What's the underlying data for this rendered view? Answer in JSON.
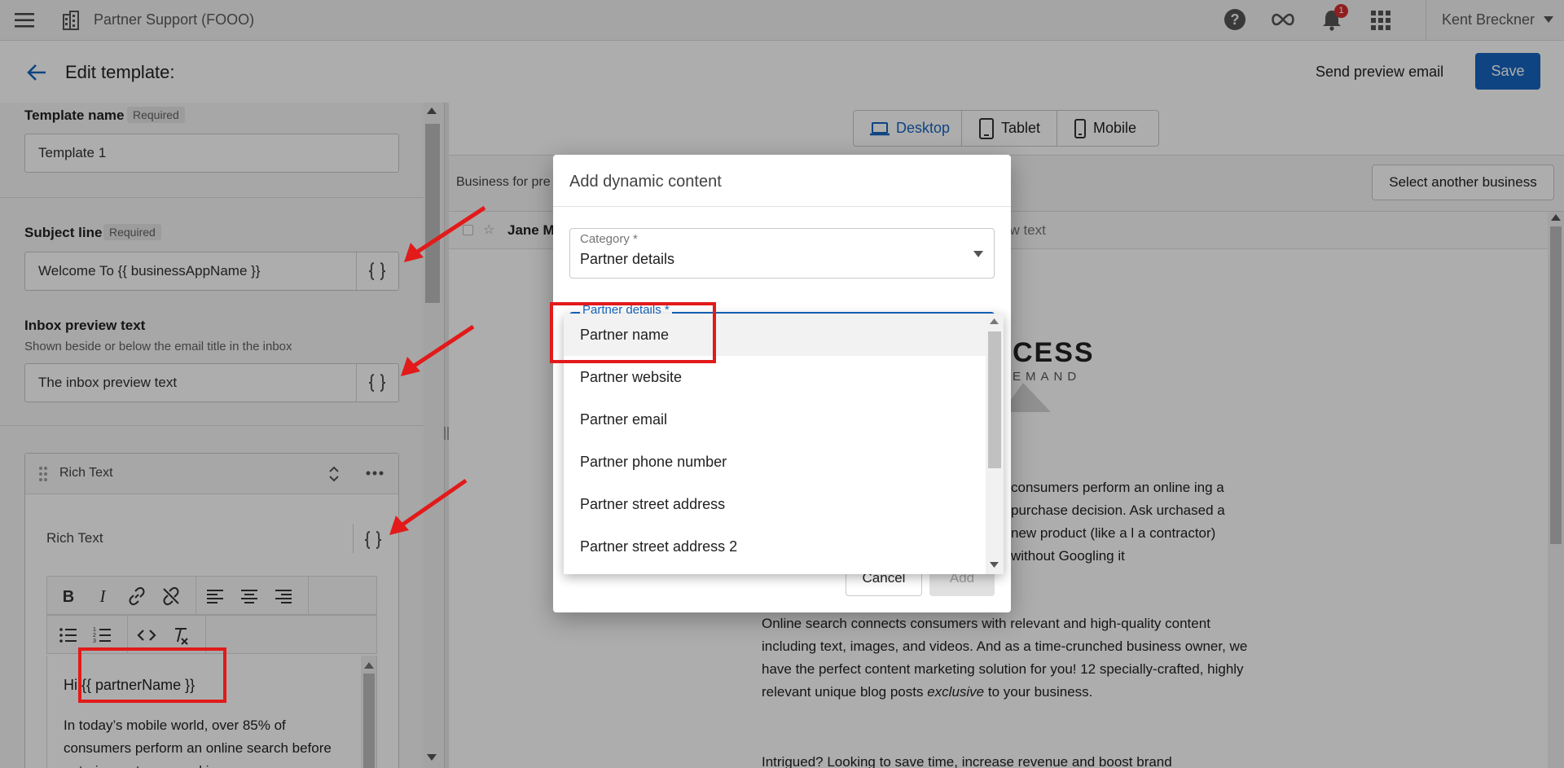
{
  "topbar": {
    "title": "Partner Support (FOOO)",
    "notification_count": "1",
    "user": "Kent Breckner"
  },
  "header": {
    "title": "Edit template:",
    "preview_link": "Send preview email",
    "save_label": "Save"
  },
  "form": {
    "template_name": {
      "label": "Template name",
      "required": "Required",
      "value": "Template 1"
    },
    "subject_line": {
      "label": "Subject line",
      "required": "Required",
      "value": "Welcome To {{ businessAppName }}"
    },
    "inbox_preview": {
      "label": "Inbox preview text",
      "hint": "Shown beside or below the email title in the inbox",
      "value": "The inbox preview text"
    }
  },
  "rich_text": {
    "title": "Rich Text",
    "label": "Rich Text",
    "editor_greeting": "Hi",
    "editor_token": "{{ partnerName }}",
    "editor_body": "In today’s mobile world, over 85% of consumers perform an online search before entering a store or making a"
  },
  "preview": {
    "devices": [
      "Desktop",
      "Tablet",
      "Mobile"
    ],
    "active_device": "Desktop",
    "business_label": "Business for pre",
    "select_business": "Select another business",
    "sender": "Jane M",
    "snippet": "ew text",
    "logo_text": "CESS",
    "logo_sub": "EMAND",
    "paragraph1": "consumers perform an online ing a purchase decision. Ask urchased a new product (like a l a contractor) without Googling it",
    "paragraph2_before": "Online search connects consumers with relevant and high-quality content including text, images, and videos. And as a time-crunched business owner, we have the perfect content marketing solution for you! 12 specially-crafted, highly relevant unique blog posts",
    "paragraph2_em": "exclusive",
    "paragraph2_after": "to your business.",
    "paragraph3": "Intrigued? Looking to save time, increase revenue and boost brand"
  },
  "dialog": {
    "title": "Add dynamic content",
    "category_label": "Category *",
    "category_value": "Partner details",
    "details_label": "Partner details *",
    "cancel_label": "Cancel",
    "add_label": "Add",
    "options": [
      "Partner name",
      "Partner website",
      "Partner email",
      "Partner phone number",
      "Partner street address",
      "Partner street address 2"
    ]
  },
  "colors": {
    "primary": "#1565c0",
    "annotation_red": "#e21a1a",
    "badge": "#d32f2f"
  },
  "icons": [
    "menu-icon",
    "building-icon",
    "help-icon",
    "infinity-icon",
    "bell-icon",
    "apps-grid-icon",
    "back-arrow-icon",
    "braces-icon",
    "drag-handle-icon",
    "reorder-icon",
    "more-icon",
    "bold-icon",
    "italic-icon",
    "link-icon",
    "unlink-icon",
    "align-left-icon",
    "align-center-icon",
    "align-right-icon",
    "bullet-list-icon",
    "numbered-list-icon",
    "code-icon",
    "clear-format-icon",
    "laptop-icon",
    "tablet-icon",
    "mobile-icon"
  ]
}
